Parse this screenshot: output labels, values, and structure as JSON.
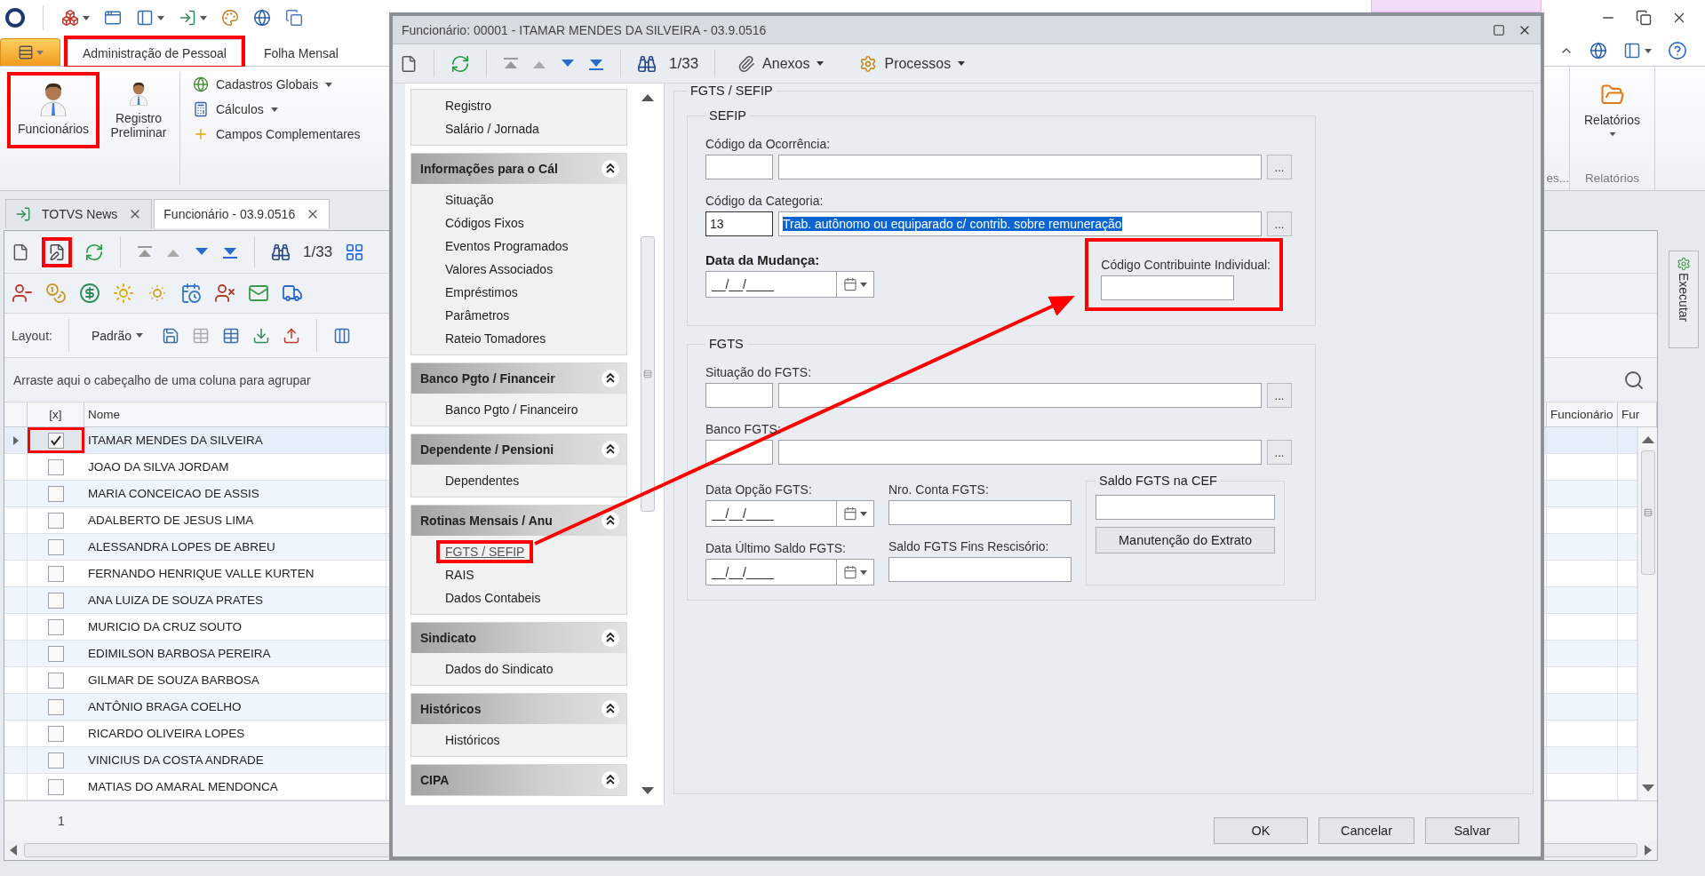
{
  "ribbon": {
    "tabs": [
      {
        "label": "Administração de Pessoal",
        "selected": true,
        "highlighted": true
      },
      {
        "label": "Folha Mensal",
        "selected": false,
        "highlighted": false
      }
    ],
    "large_buttons": [
      {
        "label": "Funcionários",
        "highlighted": true
      },
      {
        "label": "Registro Preliminar",
        "highlighted": false
      }
    ],
    "small_buttons": [
      {
        "label": "Cadastros Globais",
        "kind": "globe",
        "dropdown": true
      },
      {
        "label": "Cálculos",
        "kind": "calculator",
        "dropdown": true
      },
      {
        "label": "Campos Complementares",
        "kind": "plus",
        "dropdown": false
      }
    ],
    "cut_group_label": "es...",
    "reports_button": "Relatórios",
    "reports_group": "Relatórios"
  },
  "doc_tabs": [
    {
      "label": "TOTVS News",
      "selected": false
    },
    {
      "label": "Funcionário - 03.9.0516",
      "selected": true
    }
  ],
  "grid": {
    "record_counter": "1/33",
    "edit_highlighted": true,
    "layout_label": "Layout:",
    "layout_value": "Padrão",
    "group_hint": "Arraste aqui o cabeçalho de uma coluna para agrupar",
    "columns": [
      "[x]",
      "Nome",
      "Funcionário",
      "Fur"
    ],
    "rows": [
      {
        "name": "ITAMAR MENDES DA SILVEIRA",
        "checked": true,
        "selected": true,
        "highlighted": true
      },
      {
        "name": "JOAO DA SILVA JORDAM",
        "checked": false,
        "selected": false,
        "highlighted": false
      },
      {
        "name": "MARIA CONCEICAO DE ASSIS",
        "checked": false,
        "selected": false,
        "highlighted": false
      },
      {
        "name": "ADALBERTO DE JESUS LIMA",
        "checked": false,
        "selected": false,
        "highlighted": false
      },
      {
        "name": "ALESSANDRA LOPES DE ABREU",
        "checked": false,
        "selected": false,
        "highlighted": false
      },
      {
        "name": "FERNANDO HENRIQUE VALLE KURTEN",
        "checked": false,
        "selected": false,
        "highlighted": false
      },
      {
        "name": "ANA LUIZA  DE SOUZA PRATES",
        "checked": false,
        "selected": false,
        "highlighted": false
      },
      {
        "name": "MURICIO DA CRUZ SOUTO",
        "checked": false,
        "selected": false,
        "highlighted": false
      },
      {
        "name": "EDIMILSON BARBOSA PEREIRA",
        "checked": false,
        "selected": false,
        "highlighted": false
      },
      {
        "name": "GILMAR DE SOUZA BARBOSA",
        "checked": false,
        "selected": false,
        "highlighted": false
      },
      {
        "name": "ANTÔNIO BRAGA COELHO",
        "checked": false,
        "selected": false,
        "highlighted": false
      },
      {
        "name": "RICARDO OLIVEIRA LOPES",
        "checked": false,
        "selected": false,
        "highlighted": false
      },
      {
        "name": "VINICIUS DA COSTA ANDRADE",
        "checked": false,
        "selected": false,
        "highlighted": false
      },
      {
        "name": "MATIAS DO AMARAL MENDONCA",
        "checked": false,
        "selected": false,
        "highlighted": false
      }
    ],
    "footer_count": "1"
  },
  "side_tab": "Executar",
  "dialog": {
    "title": "Funcionário: 00001 - ITAMAR MENDES DA SILVEIRA - 03.9.0516",
    "record_counter": "1/33",
    "menus": [
      {
        "label": "Anexos",
        "kind": "attachments"
      },
      {
        "label": "Processos",
        "kind": "processes"
      }
    ],
    "nav": [
      {
        "items": [
          {
            "label": "Registro",
            "selected": false,
            "highlighted": false
          },
          {
            "label": "Salário / Jornada",
            "selected": false,
            "highlighted": false
          }
        ]
      },
      {
        "header": "Informações para o Cál",
        "expanded": true,
        "items": [
          {
            "label": "Situação",
            "selected": false,
            "highlighted": false
          },
          {
            "label": "Códigos Fixos",
            "selected": false,
            "highlighted": false
          },
          {
            "label": "Eventos Programados",
            "selected": false,
            "highlighted": false
          },
          {
            "label": "Valores Associados",
            "selected": false,
            "highlighted": false
          },
          {
            "label": "Empréstimos",
            "selected": false,
            "highlighted": false
          },
          {
            "label": "Parâmetros",
            "selected": false,
            "highlighted": false
          },
          {
            "label": "Rateio Tomadores",
            "selected": false,
            "highlighted": false
          }
        ]
      },
      {
        "header": "Banco Pgto / Financeir",
        "expanded": true,
        "items": [
          {
            "label": "Banco Pgto / Financeiro",
            "selected": false,
            "highlighted": false
          }
        ]
      },
      {
        "header": "Dependente / Pensioni",
        "expanded": true,
        "items": [
          {
            "label": "Dependentes",
            "selected": false,
            "highlighted": false
          }
        ]
      },
      {
        "header": "Rotinas Mensais / Anu",
        "expanded": true,
        "items": [
          {
            "label": "FGTS / SEFIP",
            "selected": true,
            "highlighted": true
          },
          {
            "label": "RAIS",
            "selected": false,
            "highlighted": false
          },
          {
            "label": "Dados Contabeis",
            "selected": false,
            "highlighted": false
          }
        ]
      },
      {
        "header": "Sindicato",
        "expanded": true,
        "items": [
          {
            "label": "Dados do Sindicato",
            "selected": false,
            "highlighted": false
          }
        ]
      },
      {
        "header": "Históricos",
        "expanded": true,
        "items": [
          {
            "label": "Históricos",
            "selected": false,
            "highlighted": false
          }
        ]
      },
      {
        "header": "CIPA",
        "expanded": true
      }
    ],
    "section_title": "FGTS / SEFIP",
    "sefip": {
      "title": "SEFIP",
      "ocorrencia": {
        "label": "Código da Ocorrência:",
        "button": "..."
      },
      "categoria": {
        "label": "Código da Categoria:",
        "code": "13",
        "description": "Trab. autônomo ou equiparado c/ contrib. sobre remuneração",
        "description_selected": true,
        "button": "..."
      },
      "data_mudanca": {
        "label": "Data da Mudança:",
        "mask": "__/__/____"
      },
      "contribuinte": {
        "label": "Código Contribuinte Individual:",
        "highlighted": true
      }
    },
    "fgts": {
      "title": "FGTS",
      "situacao": {
        "label": "Situação do FGTS:",
        "button": "..."
      },
      "banco": {
        "label": "Banco FGTS:",
        "button": "..."
      },
      "data_opcao": {
        "label": "Data Opção FGTS:",
        "mask": "__/__/____"
      },
      "nro_conta": {
        "label": "Nro. Conta FGTS:"
      },
      "data_ultimo": {
        "label": "Data Último Saldo FGTS:",
        "mask": "__/__/____"
      },
      "saldo_fins": {
        "label": "Saldo FGTS Fins Rescisório:"
      },
      "saldo_cef": {
        "title": "Saldo FGTS na CEF",
        "button": "Manutenção do Extrato"
      }
    },
    "buttons": [
      "OK",
      "Cancelar",
      "Salvar"
    ]
  }
}
